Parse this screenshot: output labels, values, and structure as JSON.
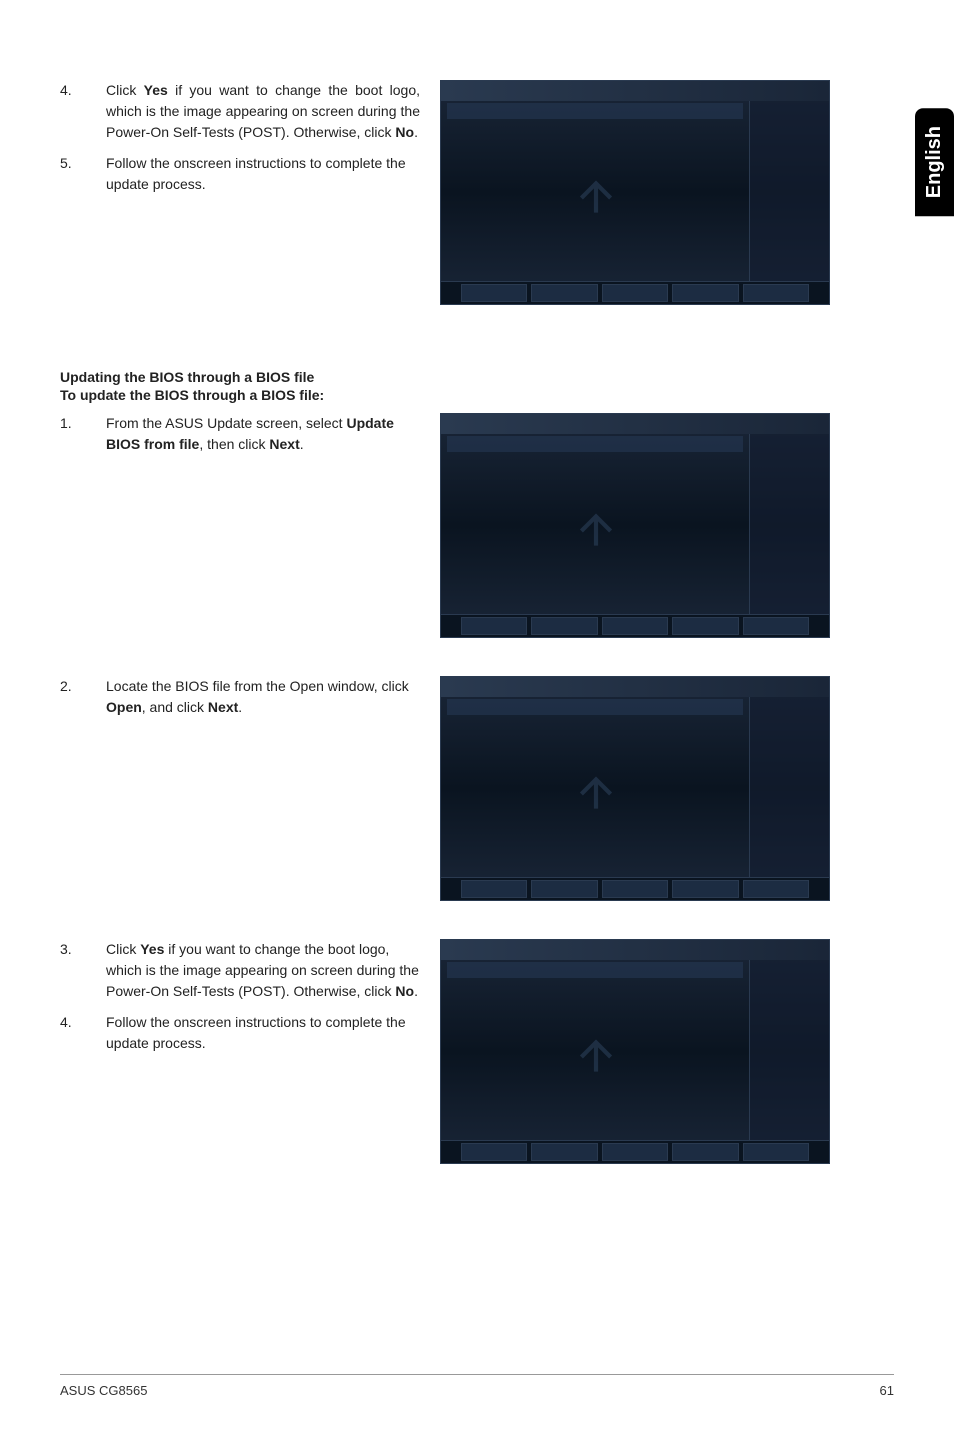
{
  "side_tab": "English",
  "section1": {
    "item4": {
      "num": "4.",
      "text_start": "Click ",
      "bold1": "Yes",
      "text_mid": " if you want to change the boot logo, which is the image appearing on screen during the Power-On Self-Tests (POST). Otherwise, click ",
      "bold2": "No",
      "text_end": "."
    },
    "item5": {
      "num": "5.",
      "text": "Follow the onscreen instructions to complete the update process."
    }
  },
  "section2_heading": "Updating the BIOS through a BIOS file",
  "section2_subheading": "To update the BIOS through a BIOS file:",
  "section2": {
    "item1": {
      "num": "1.",
      "text_start": "From the ASUS Update screen, select ",
      "bold1": "Update BIOS from file",
      "text_mid": ", then click ",
      "bold2": "Next",
      "text_end": "."
    },
    "item2": {
      "num": "2.",
      "text_start": "Locate the BIOS file from the Open window, click ",
      "bold1": "Open",
      "text_mid": ", and click ",
      "bold2": "Next",
      "text_end": "."
    },
    "item3": {
      "num": "3.",
      "text_start": "Click ",
      "bold1": "Yes",
      "text_mid": " if you want to change the boot logo, which is the image appearing on screen during the Power-On Self-Tests (POST). Otherwise, click ",
      "bold2": "No",
      "text_end": "."
    },
    "item4": {
      "num": "4.",
      "text": "Follow the onscreen instructions to complete the update process."
    }
  },
  "footer_left": "ASUS CG8565",
  "footer_right": "61"
}
